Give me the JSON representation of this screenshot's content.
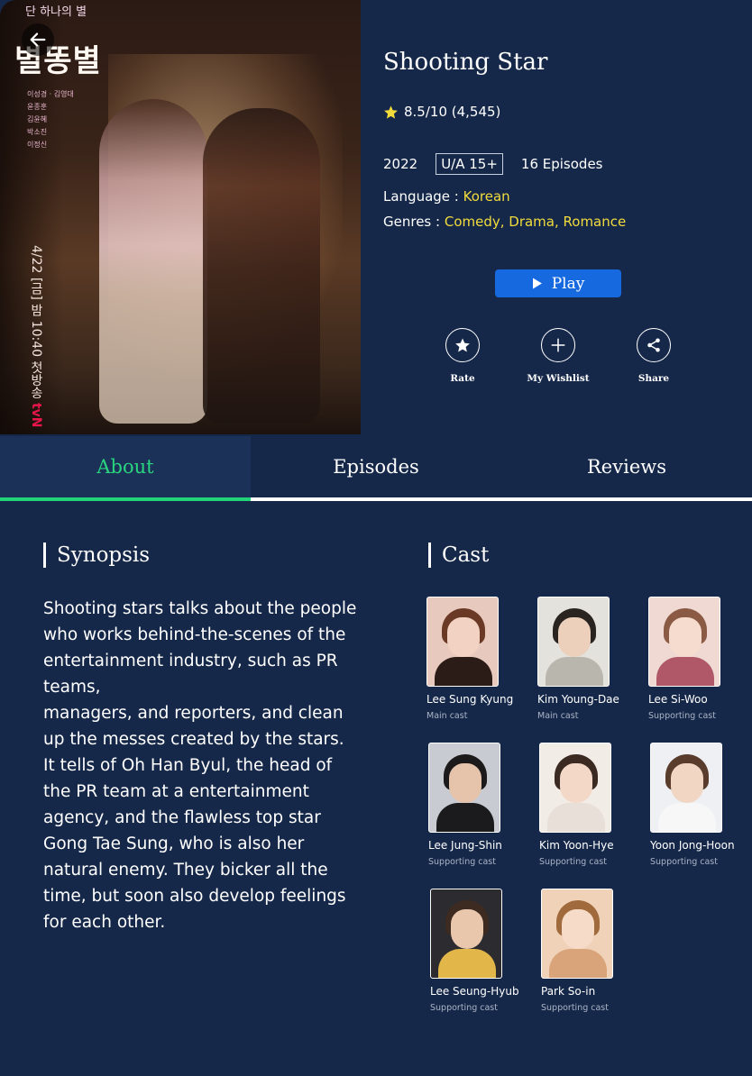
{
  "poster": {
    "tagline": "단 하나의 별",
    "logo_text": "별똥별",
    "credits": [
      "이성경 · 김영대",
      "윤종훈",
      "김윤혜",
      "박소진",
      "이정신"
    ],
    "vertical_text": "4/22 [금] 밤 10:40 첫방송",
    "network": "tvN"
  },
  "show": {
    "title": "Shooting Star",
    "rating": "8.5/10 (4,545)",
    "year": "2022",
    "certificate": "U/A 15+",
    "episodes": "16 Episodes",
    "language_label": "Language : ",
    "language": "Korean",
    "genres_label": "Genres : ",
    "genres": "Comedy, Drama, Romance"
  },
  "actions": {
    "play": "Play",
    "rate": "Rate",
    "wishlist": "My Wishlist",
    "share": "Share"
  },
  "tabs": [
    {
      "label": "About",
      "active": true
    },
    {
      "label": "Episodes",
      "active": false
    },
    {
      "label": "Reviews",
      "active": false
    }
  ],
  "synopsis": {
    "heading": "Synopsis",
    "text": "Shooting stars talks about the people who works behind-the-scenes of the entertainment industry, such as PR teams,\nmanagers, and reporters, and clean up the messes created by the stars. It tells of Oh Han Byul, the head of the PR team at a entertainment agency, and the flawless top star Gong Tae Sung, who is also her natural enemy. They bicker all the time, but soon also develop feelings for each other."
  },
  "cast": {
    "heading": "Cast",
    "members": [
      {
        "name": "Lee Sung Kyung",
        "role": "Main cast"
      },
      {
        "name": "Kim Young-Dae",
        "role": "Main cast"
      },
      {
        "name": "Lee Si-Woo",
        "role": "Supporting cast"
      },
      {
        "name": "Lee Jung-Shin",
        "role": "Supporting cast"
      },
      {
        "name": "Kim Yoon-Hye",
        "role": "Supporting cast"
      },
      {
        "name": "Yoon Jong-Hoon",
        "role": "Supporting cast"
      },
      {
        "name": "Lee Seung-Hyub",
        "role": "Supporting cast"
      },
      {
        "name": "Park So-in",
        "role": "Supporting cast"
      }
    ]
  },
  "colors": {
    "background": "#162849",
    "accent_yellow": "#f2dc3c",
    "play_blue": "#1769e0",
    "active_tab_green": "#21d478"
  },
  "icons": [
    "back-arrow-icon",
    "star-icon",
    "play-icon",
    "star-circle-icon",
    "plus-icon",
    "share-icon"
  ]
}
